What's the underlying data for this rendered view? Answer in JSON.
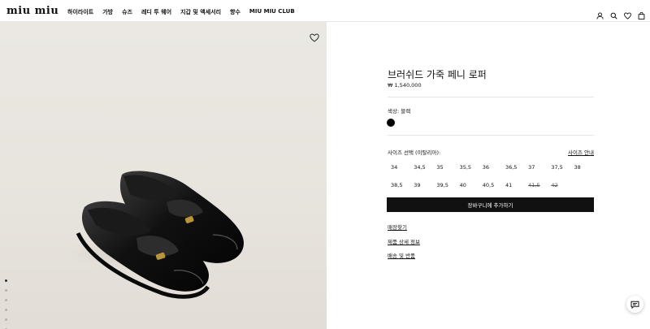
{
  "header": {
    "logo": "miu miu",
    "nav": [
      "하이라이트",
      "가방",
      "슈즈",
      "레디 투 웨어",
      "지갑 및 액세서리",
      "향수",
      "MIU MIU CLUB"
    ]
  },
  "product": {
    "title": "브러쉬드 가죽 페니 로퍼",
    "price": "₩ 1,540,000",
    "color_label": "색상: 블랙",
    "swatch_color": "#000000",
    "size_label": "사이즈 선택 (이탈리아):",
    "size_guide": "사이즈 안내",
    "sizes": [
      {
        "label": "34",
        "available": true
      },
      {
        "label": "34,5",
        "available": true
      },
      {
        "label": "35",
        "available": true
      },
      {
        "label": "35,5",
        "available": true
      },
      {
        "label": "36",
        "available": true
      },
      {
        "label": "36,5",
        "available": true
      },
      {
        "label": "37",
        "available": true
      },
      {
        "label": "37,5",
        "available": true
      },
      {
        "label": "38",
        "available": true
      },
      {
        "label": "38,5",
        "available": true
      },
      {
        "label": "39",
        "available": true
      },
      {
        "label": "39,5",
        "available": true
      },
      {
        "label": "40",
        "available": true
      },
      {
        "label": "40,5",
        "available": true
      },
      {
        "label": "41",
        "available": true
      },
      {
        "label": "41,5",
        "available": false
      },
      {
        "label": "42",
        "available": false
      }
    ],
    "add_to_cart": "장바구니에 추가하기",
    "links": {
      "store": "매장찾기",
      "details": "제품 상세 정보",
      "shipping": "배송 및 반품"
    }
  },
  "gallery": {
    "slide_count": 6,
    "active_index": 0
  }
}
